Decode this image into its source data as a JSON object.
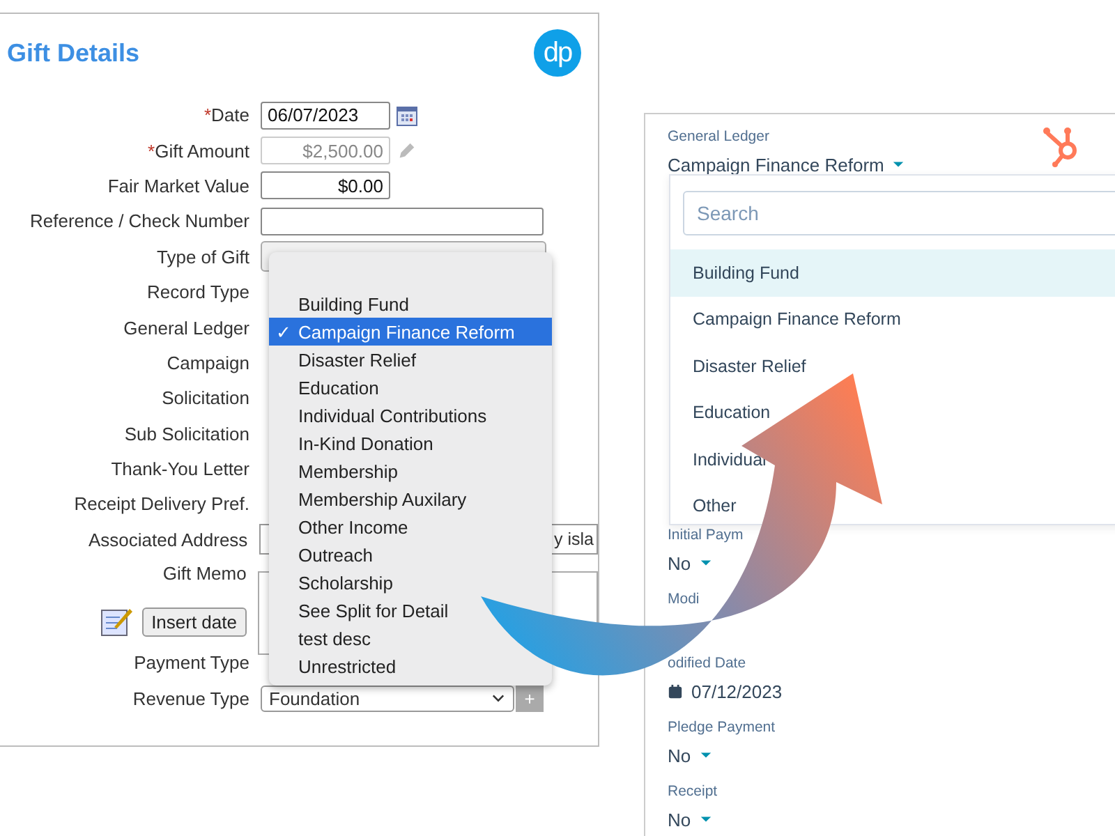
{
  "left_form": {
    "title": "Gift Details",
    "logo": "dp",
    "required_mark": "*",
    "rows": [
      {
        "label": "Date",
        "required": true,
        "kind": "date",
        "value": "06/07/2023"
      },
      {
        "label": "Gift Amount",
        "required": true,
        "kind": "locked",
        "value": "$2,500.00"
      },
      {
        "label": "Fair Market Value",
        "required": false,
        "kind": "amount",
        "value": "$0.00"
      },
      {
        "label": "Reference / Check Number",
        "required": false,
        "kind": "text"
      },
      {
        "label": "Type of Gift",
        "required": false,
        "kind": "select"
      },
      {
        "label": "Record Type",
        "required": false,
        "kind": "none"
      },
      {
        "label": "General Ledger",
        "required": false,
        "kind": "none"
      },
      {
        "label": "Campaign",
        "required": false,
        "kind": "none"
      },
      {
        "label": "Solicitation",
        "required": false,
        "kind": "none"
      },
      {
        "label": "Sub Solicitation",
        "required": false,
        "kind": "none"
      },
      {
        "label": "Thank-You Letter",
        "required": false,
        "kind": "none"
      },
      {
        "label": "Receipt Delivery Pref.",
        "required": false,
        "kind": "none"
      },
      {
        "label": "Associated Address",
        "required": false,
        "kind": "address",
        "value": "y isla"
      },
      {
        "label": "Gift Memo",
        "required": false,
        "kind": "memo"
      }
    ],
    "insert_date_button": "Insert date",
    "bottom_rows": [
      {
        "label": "Payment Type",
        "kind": "none"
      },
      {
        "label": "Revenue Type",
        "kind": "select",
        "value": "Foundation",
        "add_button": "+"
      }
    ],
    "dropdown": [
      {
        "label": "Building Fund",
        "selected": false
      },
      {
        "label": "Campaign Finance Reform",
        "selected": true
      },
      {
        "label": "Disaster Relief",
        "selected": false
      },
      {
        "label": "Education",
        "selected": false
      },
      {
        "label": "Individual Contributions",
        "selected": false
      },
      {
        "label": "In-Kind Donation",
        "selected": false
      },
      {
        "label": "Membership",
        "selected": false
      },
      {
        "label": "Membership Auxilary",
        "selected": false
      },
      {
        "label": "Other Income",
        "selected": false
      },
      {
        "label": "Outreach",
        "selected": false
      },
      {
        "label": "Scholarship",
        "selected": false
      },
      {
        "label": "See Split for Detail",
        "selected": false
      },
      {
        "label": "test desc",
        "selected": false
      },
      {
        "label": "Unrestricted",
        "selected": false
      }
    ],
    "check_mark": "✓"
  },
  "right_form": {
    "ledger_label": "General Ledger",
    "ledger_value": "Campaign Finance Reform",
    "search": {
      "placeholder": "Search"
    },
    "dropdown": [
      {
        "label": "Building Fund",
        "selected": true
      },
      {
        "label": "Campaign Finance Reform",
        "selected": false
      },
      {
        "label": "Disaster Relief",
        "selected": false
      },
      {
        "label": "Education",
        "selected": false
      },
      {
        "label": "Individual",
        "selected": false
      },
      {
        "label": "Other",
        "selected": false
      }
    ],
    "fields": [
      {
        "label": "Initial Paym",
        "kind": "select",
        "value": "No"
      },
      {
        "label": "Modi",
        "kind": "hidden"
      },
      {
        "label": "odified Date",
        "kind": "date",
        "value": "07/12/2023"
      },
      {
        "label": "Pledge Payment",
        "kind": "select",
        "value": "No"
      },
      {
        "label": "Receipt",
        "kind": "select",
        "value": "No"
      }
    ]
  }
}
